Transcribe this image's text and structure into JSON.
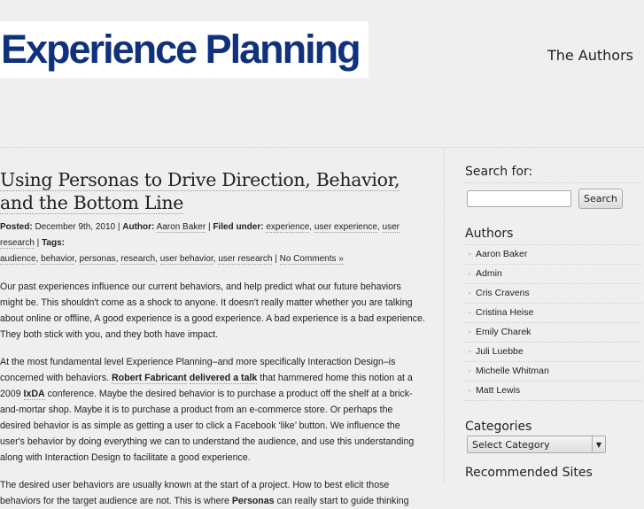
{
  "header": {
    "logo_text": "Experience Planning",
    "nav_link": "The Authors"
  },
  "post": {
    "title": "Using Personas to Drive Direction, Behavior, and the Bottom Line",
    "meta": {
      "posted_label": "Posted:",
      "date": "December 9th, 2010",
      "author_label": "Author:",
      "author": "Aaron Baker",
      "filed_label": "Filed under:",
      "categories": [
        "experience",
        "user experience",
        "user research"
      ],
      "tags_label": "Tags:",
      "tags": [
        "audience",
        "behavior",
        "personas",
        "research",
        "user behavior",
        "user research"
      ],
      "comments": "No Comments »"
    },
    "paragraphs": {
      "p1": "Our past experiences influence our current behaviors, and help predict what our future behaviors might be.  This shouldn't come as a shock to anyone.  It doesn't really matter whether you are talking about online or offline,  A good experience is a good experience.  A bad experience is a bad experience.  They both stick with you, and they both have impact.",
      "p2_a": "At the most fundamental level Experience Planning–and more specifically Interaction Design–is concerned with behaviors.  ",
      "p2_link1": "Robert Fabricant",
      "p2_link2": "delivered a talk",
      "p2_b": " that hammered home this notion at a 2009 ",
      "p2_link3": "IxDA",
      "p2_c": " conference.  Maybe the desired behavior is to purchase a product off the shelf at a brick-and-mortar shop.  Maybe it is to purchase a product from an e-commerce store.  Or perhaps the desired behavior is as simple as getting a user to click a Facebook ‘like’ button. We influence the user's behavior by doing everything we can to understand the audience, and use this understanding along with Interaction Design to facilitate a good experience.",
      "p3_a": "The desired user behaviors are usually known at the start of a project.  How to best elicit those behaviors for the target audience are not.  This is where ",
      "p3_bold": "Personas",
      "p3_b": " can really start to guide thinking"
    }
  },
  "sidebar": {
    "search_heading": "Search for:",
    "search_value": "",
    "search_button": "Search",
    "authors_heading": "Authors",
    "authors": [
      "Aaron Baker",
      "Admin",
      "Cris Cravens",
      "Cristina Heise",
      "Emily Charek",
      "Juli Luebbe",
      "Michelle Whitman",
      "Matt Lewis"
    ],
    "categories_heading": "Categories",
    "category_select": "Select Category",
    "recommended_heading": "Recommended Sites"
  }
}
